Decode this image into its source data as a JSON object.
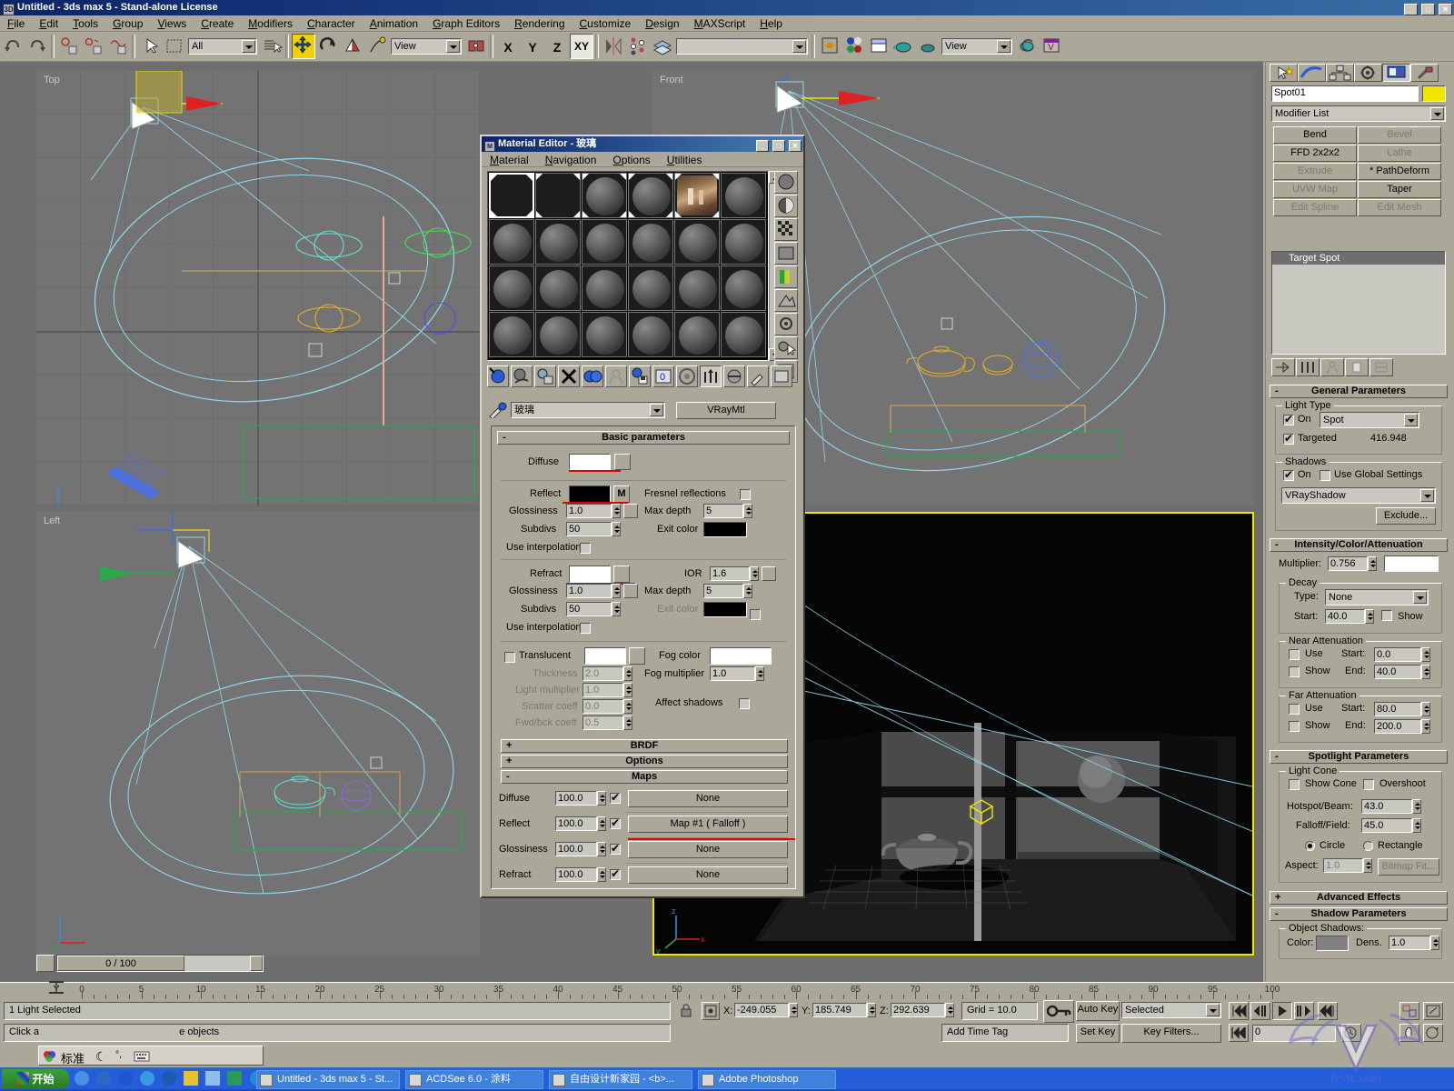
{
  "app": {
    "title": "Untitled - 3ds max 5 - Stand-alone License",
    "min": "_",
    "max": "□",
    "close": "✕"
  },
  "menu": [
    "File",
    "Edit",
    "Tools",
    "Group",
    "Views",
    "Create",
    "Modifiers",
    "Character",
    "Animation",
    "Graph Editors",
    "Rendering",
    "Customize",
    "Design",
    "MAXScript",
    "Help"
  ],
  "toolbar": {
    "selection_filter": "All",
    "ref_coord_system": "View",
    "named_selection_set": "",
    "view_dropdown": "View",
    "axis": [
      "X",
      "Y",
      "Z",
      "XY"
    ]
  },
  "viewports": [
    {
      "label": "Top"
    },
    {
      "label": "Front"
    },
    {
      "label": "Left"
    },
    {
      "label": ""
    }
  ],
  "command_panel": {
    "object_name": "Spot01",
    "modifier_list": "Modifier List",
    "buttons": [
      {
        "label": "Bend",
        "enabled": true
      },
      {
        "label": "Bevel",
        "enabled": false
      },
      {
        "label": "FFD 2x2x2",
        "enabled": true
      },
      {
        "label": "Lathe",
        "enabled": false
      },
      {
        "label": "Extrude",
        "enabled": false
      },
      {
        "label": "* PathDeform",
        "enabled": true
      },
      {
        "label": "UVW Map",
        "enabled": false
      },
      {
        "label": "Taper",
        "enabled": true
      },
      {
        "label": "Edit Spline",
        "enabled": false
      },
      {
        "label": "Edit Mesh",
        "enabled": false
      }
    ],
    "stack": [
      "Target Spot"
    ],
    "general_parameters": {
      "title": "General Parameters",
      "light_type_label": "Light Type",
      "on_label": "On",
      "on_checked": true,
      "type_value": "Spot",
      "targeted_label": "Targeted",
      "targeted_checked": true,
      "target_distance": "416.948",
      "shadows_label": "Shadows",
      "shadow_on_label": "On",
      "shadow_on_checked": true,
      "use_global_label": "Use Global Settings",
      "use_global_checked": false,
      "shadow_type": "VRayShadow",
      "exclude_label": "Exclude..."
    },
    "intensity": {
      "title": "Intensity/Color/Attenuation",
      "multiplier_label": "Multiplier:",
      "multiplier_value": "0.756",
      "light_color": "#ffffff",
      "decay_label": "Decay",
      "decay_type_label": "Type:",
      "decay_type_value": "None",
      "decay_start_label": "Start:",
      "decay_start_value": "40.0",
      "decay_show_label": "Show",
      "near_label": "Near Attenuation",
      "near_use_label": "Use",
      "near_show_label": "Show",
      "near_start_label": "Start:",
      "near_start_value": "0.0",
      "near_end_label": "End:",
      "near_end_value": "40.0",
      "far_label": "Far Attenuation",
      "far_use_label": "Use",
      "far_show_label": "Show",
      "far_start_label": "Start:",
      "far_start_value": "80.0",
      "far_end_label": "End:",
      "far_end_value": "200.0"
    },
    "spotlight": {
      "title": "Spotlight Parameters",
      "cone_label": "Light Cone",
      "show_cone_label": "Show Cone",
      "overshoot_label": "Overshoot",
      "hotspot_label": "Hotspot/Beam:",
      "hotspot_value": "43.0",
      "falloff_label": "Falloff/Field:",
      "falloff_value": "45.0",
      "circle_label": "Circle",
      "rectangle_label": "Rectangle",
      "aspect_label": "Aspect:",
      "aspect_value": "1.0",
      "bitmap_fit_label": "Bitmap Fit..."
    },
    "advanced_effects": "Advanced Effects",
    "shadow_parameters": "Shadow Parameters",
    "object_shadows_label": "Object Shadows:",
    "shadow_color_label": "Color:",
    "shadow_dens_label": "Dens.",
    "shadow_dens_value": "1.0"
  },
  "material_editor": {
    "title": "Material Editor - 玻璃",
    "menu": [
      "Material",
      "Navigation",
      "Options",
      "Utilities"
    ],
    "material_name": "玻璃",
    "material_type": "VRayMtl",
    "basic_title": "Basic parameters",
    "diffuse_label": "Diffuse",
    "diffuse_color": "#ffffff",
    "reflect_label": "Reflect",
    "reflect_color": "#000000",
    "reflect_map_btn": "M",
    "refl_gloss_label": "Glossiness",
    "refl_gloss_value": "1.0",
    "refl_subdivs_label": "Subdivs",
    "refl_subdivs_value": "50",
    "refl_interp_label": "Use interpolation",
    "fresnel_label": "Fresnel reflections",
    "refl_maxdepth_label": "Max depth",
    "refl_maxdepth_value": "5",
    "refl_exit_label": "Exit color",
    "refl_exit_color": "#000000",
    "refract_label": "Refract",
    "refract_color": "#ffffff",
    "refr_gloss_label": "Glossiness",
    "refr_gloss_value": "1.0",
    "refr_subdivs_label": "Subdivs",
    "refr_subdivs_value": "50",
    "refr_interp_label": "Use interpolation",
    "ior_label": "IOR",
    "ior_value": "1.6",
    "refr_maxdepth_label": "Max depth",
    "refr_maxdepth_value": "5",
    "refr_exit_label": "Exit color",
    "refr_exit_color": "#000000",
    "translucent_label": "Translucent",
    "translucent_color": "#ffffff",
    "thickness_label": "Thickness",
    "thickness_value": "2.0",
    "light_mult_label": "Light multiplier",
    "light_mult_value": "1.0",
    "scatter_label": "Scatter coeff",
    "scatter_value": "0.0",
    "fwdbck_label": "Fwd/bck coeff",
    "fwdbck_value": "0.5",
    "fog_color_label": "Fog color",
    "fog_color": "#ffffff",
    "fog_mult_label": "Fog multiplier",
    "fog_mult_value": "1.0",
    "affect_shadows_label": "Affect shadows",
    "brdf_title": "BRDF",
    "options_title": "Options",
    "maps_title": "Maps",
    "maps": [
      {
        "name": "Diffuse",
        "amount": "100.0",
        "on": true,
        "slot": "None"
      },
      {
        "name": "Reflect",
        "amount": "100.0",
        "on": true,
        "slot": "Map #1  ( Falloff )"
      },
      {
        "name": "Glossiness",
        "amount": "100.0",
        "on": true,
        "slot": "None"
      },
      {
        "name": "Refract",
        "amount": "100.0",
        "on": true,
        "slot": "None"
      }
    ]
  },
  "timeline": {
    "current": "0 / 100",
    "ticks": [
      "0",
      "5",
      "10",
      "15",
      "20",
      "25",
      "30",
      "35",
      "40",
      "45",
      "50",
      "55",
      "60",
      "65",
      "70",
      "75",
      "80",
      "85",
      "90",
      "95",
      "100"
    ]
  },
  "status": {
    "selection": "1 Light Selected",
    "prompt_left": "Click a",
    "prompt_right": "e objects",
    "x_label": "X:",
    "x_value": "-249.055",
    "y_label": "Y:",
    "y_value": "185.749",
    "z_label": "Z:",
    "z_value": "292.639",
    "grid": "Grid = 10.0",
    "auto_key": "Auto Key",
    "set_key": "Set Key",
    "key_mode": "Selected",
    "key_filters": "Key Filters...",
    "frame_value": "0",
    "add_time_tag": "Add Time Tag"
  },
  "ime": {
    "mode": "标准"
  },
  "taskbar": {
    "start": "开始",
    "apps": [
      "Untitled - 3ds max 5 - St...",
      "ACDSee 6.0 - 涂料",
      "自由设计新家园 - <b>...",
      "Adobe Photoshop"
    ]
  },
  "watermark": {
    "text": "fevte.com"
  }
}
